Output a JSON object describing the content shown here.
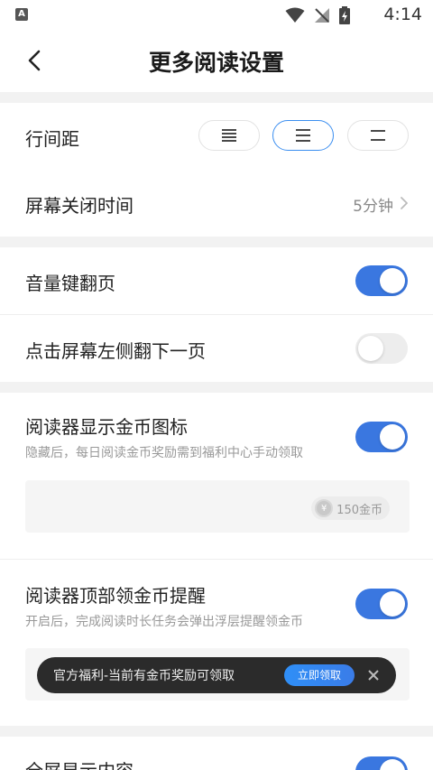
{
  "status_bar": {
    "time": "4:14",
    "app_badge": "A"
  },
  "header": {
    "title": "更多阅读设置"
  },
  "line_spacing": {
    "label": "行间距",
    "options": [
      "compact",
      "medium",
      "loose"
    ],
    "selected_index": 1
  },
  "screen_off": {
    "label": "屏幕关闭时间",
    "value": "5分钟"
  },
  "volume_page_turn": {
    "label": "音量键翻页",
    "enabled": true
  },
  "tap_left_next": {
    "label": "点击屏幕左侧翻下一页",
    "enabled": false
  },
  "coin_icon": {
    "label": "阅读器显示金币图标",
    "description": "隐藏后，每日阅读金币奖励需到福利中心手动领取",
    "enabled": true,
    "preview": {
      "coin_symbol": "¥",
      "coin_text": "150金币"
    }
  },
  "coin_reminder": {
    "label": "阅读器顶部领金币提醒",
    "description": "开启后，完成阅读时长任务会弹出浮层提醒领金币",
    "enabled": true,
    "preview": {
      "banner_text": "官方福利-当前有金币奖励可领取",
      "button_label": "立即领取"
    }
  },
  "fullscreen": {
    "label": "全屏显示内容",
    "enabled": true
  },
  "colors": {
    "accent": "#3a77e0",
    "toggle_off": "#ededed"
  }
}
